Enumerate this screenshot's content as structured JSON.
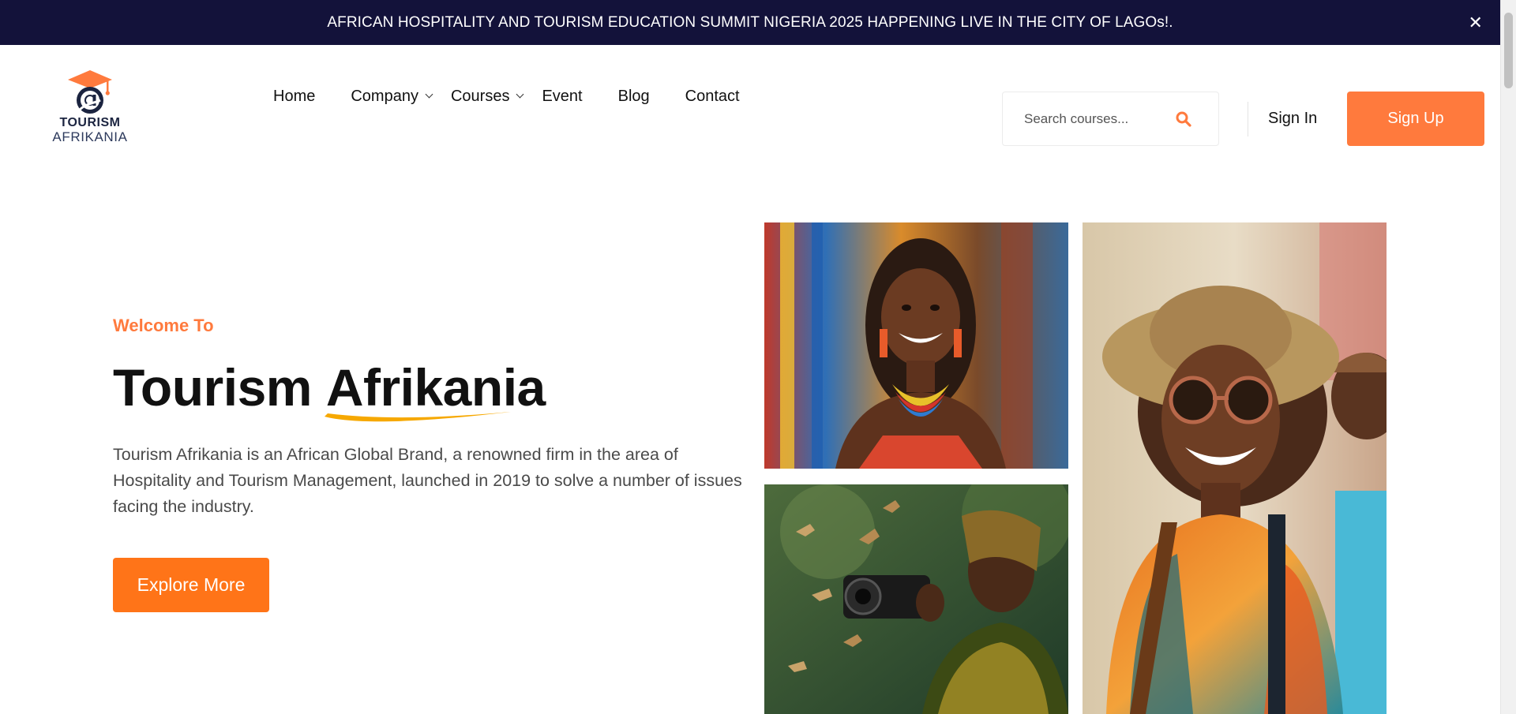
{
  "announcement": {
    "text": "AFRICAN HOSPITALITY AND TOURISM EDUCATION SUMMIT NIGERIA 2025 HAPPENING LIVE IN THE CITY OF LAGOs!.",
    "close_icon": "close-icon"
  },
  "logo": {
    "line1": "TOURISM",
    "line2": "AFRIKANIA"
  },
  "nav": {
    "items": [
      {
        "label": "Home",
        "has_dropdown": false
      },
      {
        "label": "Company",
        "has_dropdown": true
      },
      {
        "label": "Courses",
        "has_dropdown": true
      },
      {
        "label": "Event",
        "has_dropdown": false
      },
      {
        "label": "Blog",
        "has_dropdown": false
      },
      {
        "label": "Contact",
        "has_dropdown": false
      }
    ]
  },
  "search": {
    "placeholder": "Search courses...",
    "value": "",
    "icon": "search-icon"
  },
  "auth": {
    "signin_label": "Sign In",
    "signup_label": "Sign Up"
  },
  "hero": {
    "eyebrow": "Welcome To",
    "title_plain": "Tourism",
    "title_accent": "Afrikania",
    "description": "Tourism Afrikania is an African Global Brand, a renowned firm in the area of Hospitality and Tourism Management, launched in 2019 to solve a number of issues facing the industry.",
    "cta_label": "Explore More"
  },
  "colors": {
    "topbar_bg": "#13123a",
    "accent": "#ff7a3d",
    "cta": "#ff7418",
    "swoosh": "#f6a800"
  }
}
